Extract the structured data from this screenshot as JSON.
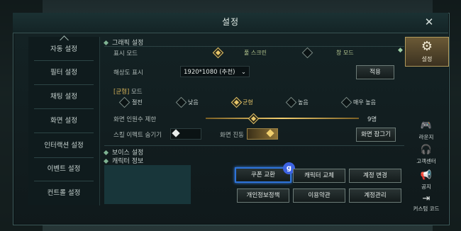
{
  "window": {
    "title": "설정",
    "close_icon": "close-icon"
  },
  "sidebar": {
    "items": [
      {
        "label": "자동 설정"
      },
      {
        "label": "필터 설정"
      },
      {
        "label": "채팅 설정"
      },
      {
        "label": "화면 설정"
      },
      {
        "label": "인터랙션 설정"
      },
      {
        "label": "이벤트 설정"
      },
      {
        "label": "컨트롤 설정"
      }
    ]
  },
  "graphics": {
    "section_title": "그래픽 설정",
    "display_mode_label": "표시 모드",
    "display_modes": [
      "풀 스크린",
      "창 모드"
    ],
    "resolution_label": "해상도 표시",
    "resolution_value": "1920*1080 (추천)",
    "apply_label": "적용",
    "quality_mode_label_prefix": "[균형]",
    "quality_mode_label_suffix": "모드",
    "quality_options": [
      "절전",
      "낮음",
      "균형",
      "높음",
      "매우 높음"
    ],
    "quality_selected": "균형",
    "screen_people_label": "화면 인원수 제한",
    "screen_people_value": "9명",
    "skill_effect_label": "스킬 이펙트 숨기기",
    "screen_shake_label": "화면 진동",
    "screen_lock_label": "화면 잠그기"
  },
  "voice": {
    "section_title": "보이스 설정"
  },
  "character": {
    "section_title": "캐릭터 정보",
    "buttons": [
      "쿠폰 교환",
      "캐릭터 교체",
      "계정 변경",
      "개인정보정책",
      "이용약관",
      "계정관리"
    ],
    "badge": "g"
  },
  "right_panel": {
    "settings_label": "설정",
    "items": [
      "라운지",
      "고객센터",
      "공지",
      "커스텀 코드"
    ]
  },
  "colors": {
    "accent_gold": "#e8c76a",
    "highlight_blue": "#2e73d8"
  }
}
